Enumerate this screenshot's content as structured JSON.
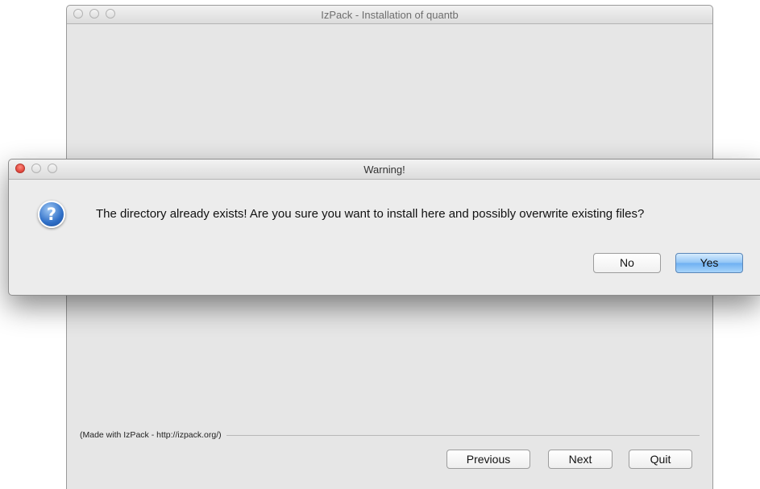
{
  "main_window": {
    "title": "IzPack - Installation of quantb",
    "credit": "(Made with IzPack - http://izpack.org/)",
    "buttons": {
      "previous": "Previous",
      "next": "Next",
      "quit": "Quit"
    }
  },
  "dialog": {
    "title": "Warning!",
    "icon": "question-icon",
    "icon_glyph": "?",
    "message": "The directory already exists! Are you sure you want to install here and possibly overwrite existing files?",
    "buttons": {
      "no": "No",
      "yes": "Yes"
    },
    "default_button": "yes",
    "accent_color": "#6eb0f2"
  }
}
